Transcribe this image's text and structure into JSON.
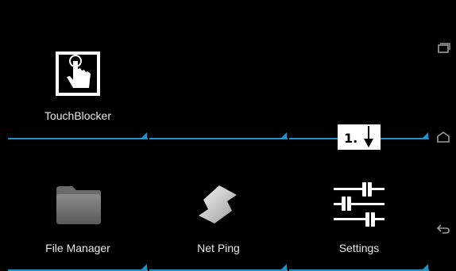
{
  "apps": {
    "touchblocker": {
      "label": "TouchBlocker",
      "icon": "hand-touch-icon"
    },
    "file_manager": {
      "label": "File Manager",
      "icon": "folder-icon"
    },
    "net_ping": {
      "label": "Net Ping",
      "icon": "net-ping-icon"
    },
    "settings": {
      "label": "Settings",
      "icon": "sliders-icon"
    }
  },
  "callout": {
    "text": "1."
  },
  "navbar": {
    "buttons": [
      "recent-apps-icon",
      "home-icon",
      "back-icon"
    ]
  },
  "colors": {
    "accent": "#1e93c9",
    "background": "#000000",
    "label": "#e8e8e8"
  }
}
